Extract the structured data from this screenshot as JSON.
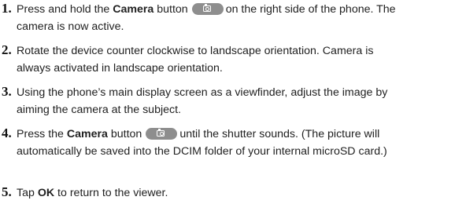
{
  "steps": [
    {
      "number": "1.",
      "line1_before": "Press and hold the ",
      "line1_bold": "Camera",
      "line1_mid": " button",
      "line1_after": "on the right side of the phone. The",
      "line2": "camera is now active.",
      "button_icon": "camera-icon"
    },
    {
      "number": "2.",
      "line1": "Rotate the device counter clockwise to landscape orientation. Camera is",
      "line2": "always activated in landscape orientation."
    },
    {
      "number": "3.",
      "line1": "Using the phone’s main display screen as a viewfinder, adjust the image by",
      "line2": "aiming the camera at the subject."
    },
    {
      "number": "4.",
      "line1_before": "Press the ",
      "line1_bold": "Camera",
      "line1_mid": " button",
      "line1_after": "until the shutter sounds. (The picture will",
      "line2": "automatically be saved into the DCIM folder of your internal microSD card.)",
      "button_icon": "camera-icon"
    },
    {
      "number": "5.",
      "line1_before": "Tap ",
      "line1_bold": "OK",
      "line1_after": " to return to the viewer."
    }
  ]
}
